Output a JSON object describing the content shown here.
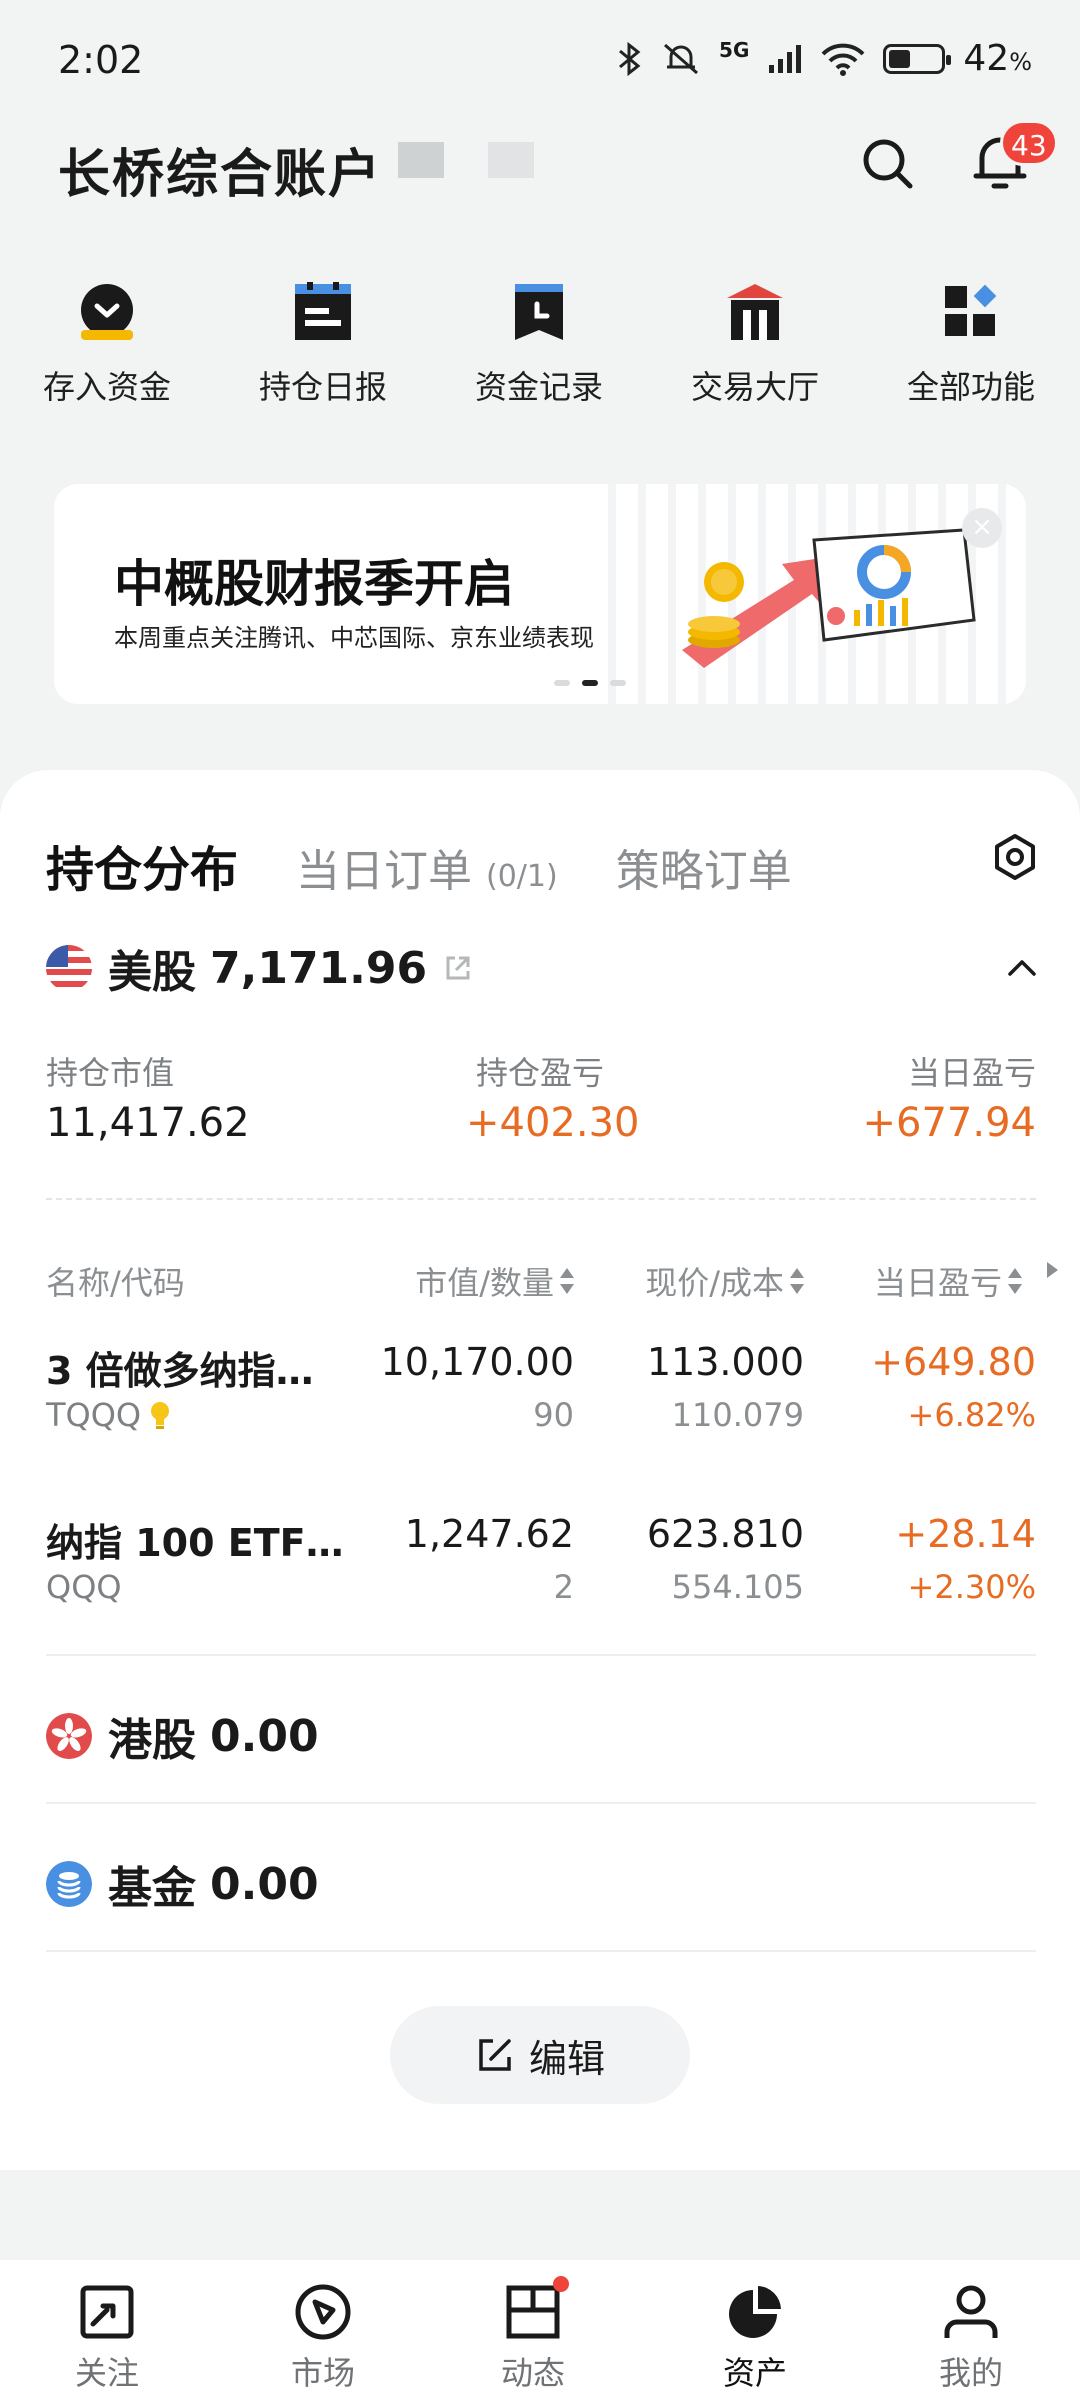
{
  "status_bar": {
    "time": "2:02",
    "network": "5G",
    "battery_pct": "42",
    "battery_unit": "%",
    "battery_level": 0.42
  },
  "header": {
    "account_title": "长桥综合账户",
    "notification_count": "43"
  },
  "quick_actions": [
    {
      "label": "存入资金",
      "icon": "deposit-icon"
    },
    {
      "label": "持仓日报",
      "icon": "calendar-report-icon"
    },
    {
      "label": "资金记录",
      "icon": "bookmark-record-icon"
    },
    {
      "label": "交易大厅",
      "icon": "trading-hall-icon"
    },
    {
      "label": "全部功能",
      "icon": "all-functions-icon"
    }
  ],
  "banner": {
    "title": "中概股财报季开启",
    "subtitle": "本周重点关注腾讯、中芯国际、京东业绩表现",
    "close": "×",
    "active_dot": 2,
    "dot_count": 3
  },
  "tabs": {
    "active": "持仓分布",
    "orders": "当日订单",
    "orders_count": "(0/1)",
    "strategy": "策略订单"
  },
  "us_market": {
    "label": "美股",
    "value": "7,171.96",
    "summary": {
      "market_value_label": "持仓市值",
      "market_value": "11,417.62",
      "position_pl_label": "持仓盈亏",
      "position_pl": "+402.30",
      "day_pl_label": "当日盈亏",
      "day_pl": "+677.94"
    },
    "columns": {
      "name": "名称/代码",
      "value_qty": "市值/数量",
      "price_cost": "现价/成本",
      "day_pl": "当日盈亏"
    },
    "positions": [
      {
        "name": "3 倍做多纳指…",
        "code": "TQQQ",
        "market_value": "10,170.00",
        "quantity": "90",
        "price": "113.000",
        "cost": "110.079",
        "day_pl": "+649.80",
        "day_pl_pct": "+6.82%"
      },
      {
        "name": "纳指 100 ETF…",
        "code": "QQQ",
        "market_value": "1,247.62",
        "quantity": "2",
        "price": "623.810",
        "cost": "554.105",
        "day_pl": "+28.14",
        "day_pl_pct": "+2.30%"
      }
    ]
  },
  "hk_market": {
    "label": "港股",
    "value": "0.00"
  },
  "fund_market": {
    "label": "基金",
    "value": "0.00"
  },
  "edit_button": "编辑",
  "bottom_nav": [
    {
      "label": "关注",
      "icon": "watchlist-icon"
    },
    {
      "label": "市场",
      "icon": "market-compass-icon"
    },
    {
      "label": "动态",
      "icon": "feed-icon"
    },
    {
      "label": "资产",
      "icon": "assets-pie-icon",
      "active": true
    },
    {
      "label": "我的",
      "icon": "profile-icon"
    }
  ],
  "colors": {
    "profit": "#e76b23",
    "accent_blue": "#4a90e2",
    "badge_red": "#f0433a"
  }
}
